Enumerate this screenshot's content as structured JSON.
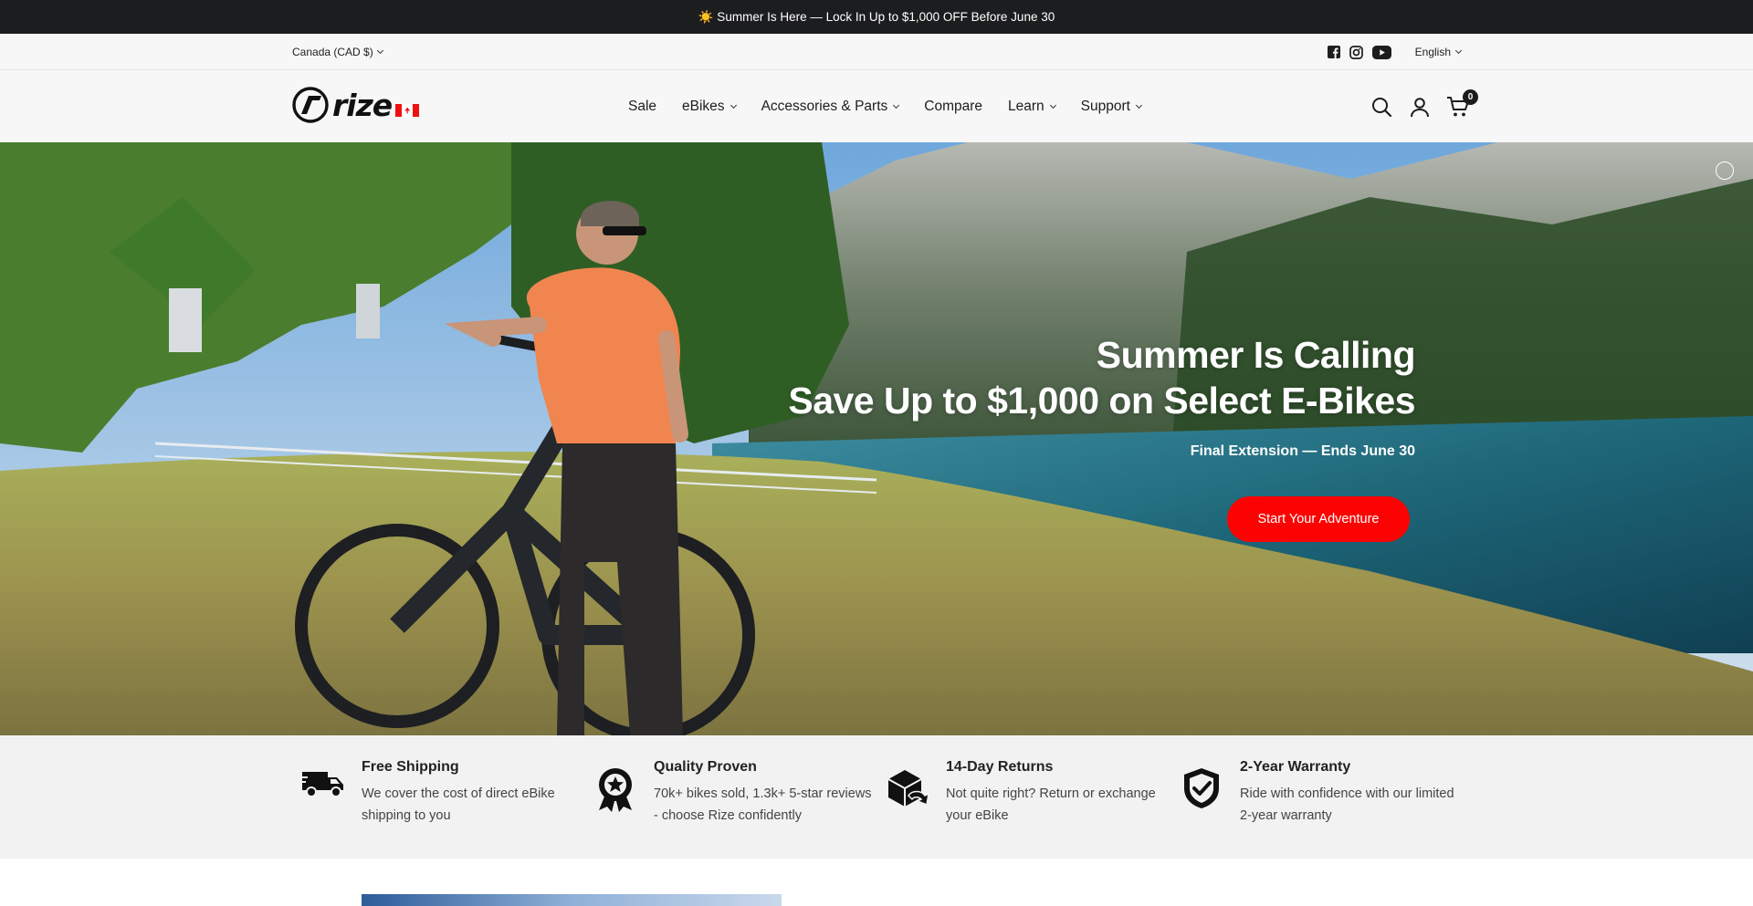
{
  "announcement": {
    "icon": "sun-icon",
    "text": "☀️ Summer Is Here — Lock In Up to $1,000 OFF Before June 30"
  },
  "utility": {
    "country": "Canada (CAD $)",
    "language": "English",
    "social": [
      "facebook-icon",
      "instagram-icon",
      "youtube-icon"
    ]
  },
  "header": {
    "logo_text": "rize",
    "nav": [
      {
        "label": "Sale",
        "dropdown": false
      },
      {
        "label": "eBikes",
        "dropdown": true
      },
      {
        "label": "Accessories & Parts",
        "dropdown": true
      },
      {
        "label": "Compare",
        "dropdown": false
      },
      {
        "label": "Learn",
        "dropdown": true
      },
      {
        "label": "Support",
        "dropdown": true
      }
    ],
    "cart_count": "0"
  },
  "hero": {
    "heading_line1": "Summer Is Calling",
    "heading_line2": "Save Up to $1,000 on Select E-Bikes",
    "subtext": "Final Extension — Ends June 30",
    "cta": "Start Your Adventure",
    "cta_color": "#fc0303"
  },
  "features": [
    {
      "icon": "delivery-truck-icon",
      "title": "Free Shipping",
      "desc": "We cover the cost of direct eBike shipping to you"
    },
    {
      "icon": "award-ribbon-icon",
      "title": "Quality Proven",
      "desc": "70k+ bikes sold, 1.3k+ 5-star reviews - choose Rize confidently"
    },
    {
      "icon": "return-box-icon",
      "title": "14-Day Returns",
      "desc": "Not quite right? Return or exchange your eBike"
    },
    {
      "icon": "shield-check-icon",
      "title": "2-Year Warranty",
      "desc": "Ride with confidence with our limited 2-year warranty"
    }
  ]
}
